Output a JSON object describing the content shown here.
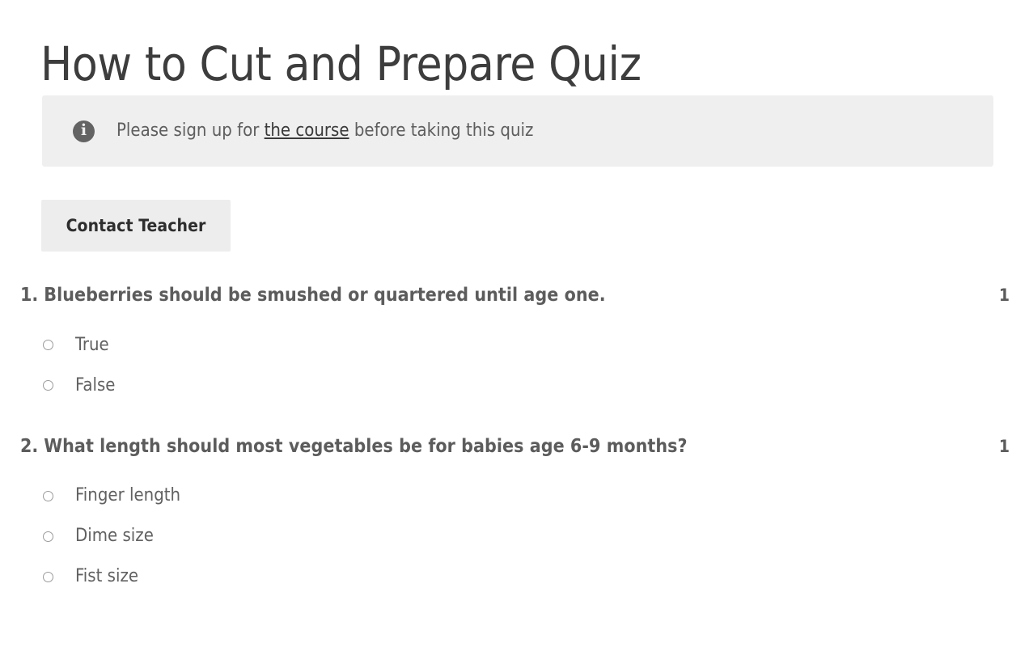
{
  "page": {
    "title": "How to Cut and Prepare Quiz"
  },
  "notice": {
    "icon": "info-circle-icon",
    "text_before": "Please sign up for ",
    "link_text": "the course",
    "text_after": " before taking this quiz"
  },
  "actions": {
    "contact_teacher_label": "Contact Teacher"
  },
  "questions": [
    {
      "number": "1.",
      "text": "Blueberries should be smushed or quartered until age one.",
      "points": "1",
      "options": [
        {
          "label": "True"
        },
        {
          "label": "False"
        }
      ]
    },
    {
      "number": "2.",
      "text": "What length should most vegetables be for babies age 6-9 months?",
      "points": "1",
      "options": [
        {
          "label": "Finger length"
        },
        {
          "label": "Dime size"
        },
        {
          "label": "Fist size"
        }
      ]
    }
  ],
  "colors": {
    "banner_bg": "#efefef",
    "button_bg": "#ededed",
    "question_text": "#5c5c5c",
    "option_text": "#616161",
    "title_text": "#3d3d3d"
  }
}
